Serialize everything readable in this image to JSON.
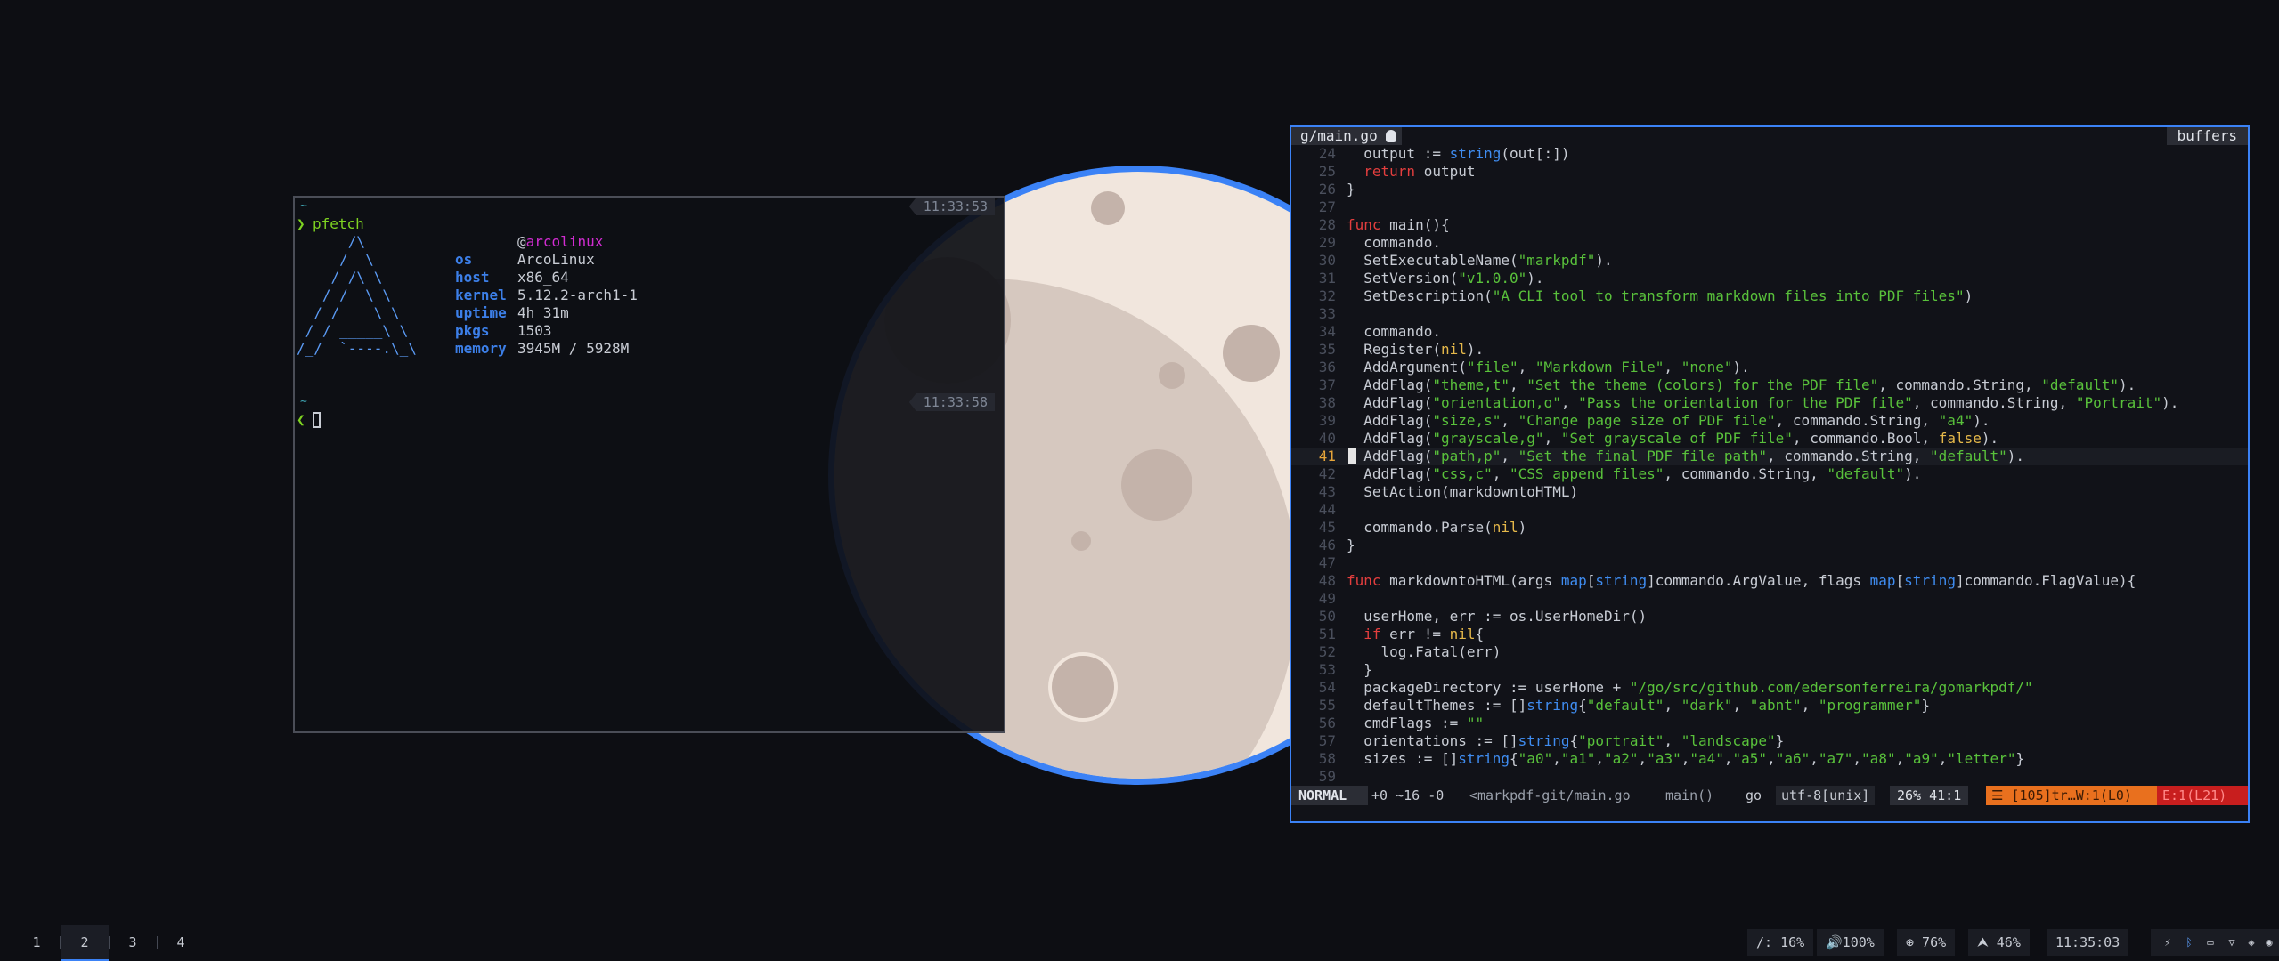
{
  "terminal": {
    "blocks": [
      {
        "tilde": "~",
        "time": "11:33:53",
        "prompt": "❯",
        "command": "pfetch"
      },
      {
        "tilde": "~",
        "time": "11:33:58",
        "prompt": "❮",
        "command": ""
      }
    ],
    "pfetch": {
      "user_at": "@",
      "host_name": "arcolinux",
      "ascii": [
        "      /\\",
        "     /  \\",
        "    / /\\ \\",
        "   / /  \\ \\",
        "  / /    \\ \\",
        " / / _____\\ \\",
        "/_/  `----.\\_\\"
      ],
      "info": [
        {
          "key": "os",
          "value": "ArcoLinux"
        },
        {
          "key": "host",
          "value": "x86_64"
        },
        {
          "key": "kernel",
          "value": "5.12.2-arch1-1"
        },
        {
          "key": "uptime",
          "value": "4h 31m"
        },
        {
          "key": "pkgs",
          "value": "1503"
        },
        {
          "key": "memory",
          "value": "3945M / 5928M"
        }
      ]
    }
  },
  "editor": {
    "tab_title": "g/main.go",
    "tab_icon": "gopher-icon",
    "buffers_label": "buffers",
    "current_line": 41,
    "lines": [
      {
        "n": 24,
        "t": "  output := string(out[:])"
      },
      {
        "n": 25,
        "t": "  return output"
      },
      {
        "n": 26,
        "t": "}"
      },
      {
        "n": 27,
        "t": ""
      },
      {
        "n": 28,
        "t": "func main(){"
      },
      {
        "n": 29,
        "t": "  commando."
      },
      {
        "n": 30,
        "t": "  SetExecutableName(\"markpdf\")."
      },
      {
        "n": 31,
        "t": "  SetVersion(\"v1.0.0\")."
      },
      {
        "n": 32,
        "t": "  SetDescription(\"A CLI tool to transform markdown files into PDF files\")"
      },
      {
        "n": 33,
        "t": ""
      },
      {
        "n": 34,
        "t": "  commando."
      },
      {
        "n": 35,
        "t": "  Register(nil)."
      },
      {
        "n": 36,
        "t": "  AddArgument(\"file\", \"Markdown File\", \"none\")."
      },
      {
        "n": 37,
        "t": "  AddFlag(\"theme,t\", \"Set the theme (colors) for the PDF file\", commando.String, \"default\")."
      },
      {
        "n": 38,
        "t": "  AddFlag(\"orientation,o\", \"Pass the orientation for the PDF file\", commando.String, \"Portrait\")."
      },
      {
        "n": 39,
        "t": "  AddFlag(\"size,s\", \"Change page size of PDF file\", commando.String, \"a4\")."
      },
      {
        "n": 40,
        "t": "  AddFlag(\"grayscale,g\", \"Set grayscale of PDF file\", commando.Bool, false)."
      },
      {
        "n": 41,
        "t": "  AddFlag(\"path,p\", \"Set the final PDF file path\", commando.String, \"default\")."
      },
      {
        "n": 42,
        "t": "  AddFlag(\"css,c\", \"CSS append files\", commando.String, \"default\")."
      },
      {
        "n": 43,
        "t": "  SetAction(markdowntoHTML)"
      },
      {
        "n": 44,
        "t": ""
      },
      {
        "n": 45,
        "t": "  commando.Parse(nil)"
      },
      {
        "n": 46,
        "t": "}"
      },
      {
        "n": 47,
        "t": ""
      },
      {
        "n": 48,
        "t": "func markdowntoHTML(args map[string]commando.ArgValue, flags map[string]commando.FlagValue){"
      },
      {
        "n": 49,
        "t": ""
      },
      {
        "n": 50,
        "t": "  userHome, err := os.UserHomeDir()"
      },
      {
        "n": 51,
        "t": "  if err != nil{"
      },
      {
        "n": 52,
        "t": "    log.Fatal(err)"
      },
      {
        "n": 53,
        "t": "  }"
      },
      {
        "n": 54,
        "t": "  packageDirectory := userHome + \"/go/src/github.com/edersonferreira/gomarkpdf/\""
      },
      {
        "n": 55,
        "t": "  defaultThemes := []string{\"default\", \"dark\", \"abnt\", \"programmer\"}"
      },
      {
        "n": 56,
        "t": "  cmdFlags := \"\""
      },
      {
        "n": 57,
        "t": "  orientations := []string{\"portrait\", \"landscape\"}"
      },
      {
        "n": 58,
        "t": "  sizes := []string{\"a0\",\"a1\",\"a2\",\"a3\",\"a4\",\"a5\",\"a6\",\"a7\",\"a8\",\"a9\",\"letter\"}"
      },
      {
        "n": 59,
        "t": ""
      }
    ],
    "status": {
      "mode": "NORMAL",
      "git_diff": "+0 ~16 -0",
      "file": "<markpdf-git/main.go",
      "function": "main()",
      "filetype": "go",
      "encoding": "utf-8[unix]",
      "position": "26% 41:1",
      "warnings": "☰ [105]tr…W:1(L0)",
      "errors": "E:1(L21)"
    }
  },
  "bar": {
    "workspaces": [
      "1",
      "2",
      "3",
      "4"
    ],
    "active_workspace": "2",
    "modules": [
      {
        "icon": "disk-icon",
        "text": "/: 16%"
      },
      {
        "icon": "volume-icon",
        "text": "🔊100%"
      },
      {
        "icon": "cpu-icon",
        "text": "⊕ 76%"
      },
      {
        "icon": "arch-icon",
        "text": "⮝ 46%"
      },
      {
        "icon": "clock-icon",
        "text": "11:35:03"
      }
    ],
    "tray": [
      "app-icon",
      "bluetooth-icon",
      "display-icon",
      "vpn-icon",
      "security-icon",
      "discord-icon"
    ]
  },
  "colors": {
    "accent": "#3b82f6",
    "background": "#0d0e13",
    "moon": "#f1e6dd",
    "status_warn": "#e9701e",
    "status_err": "#c81e1e"
  }
}
